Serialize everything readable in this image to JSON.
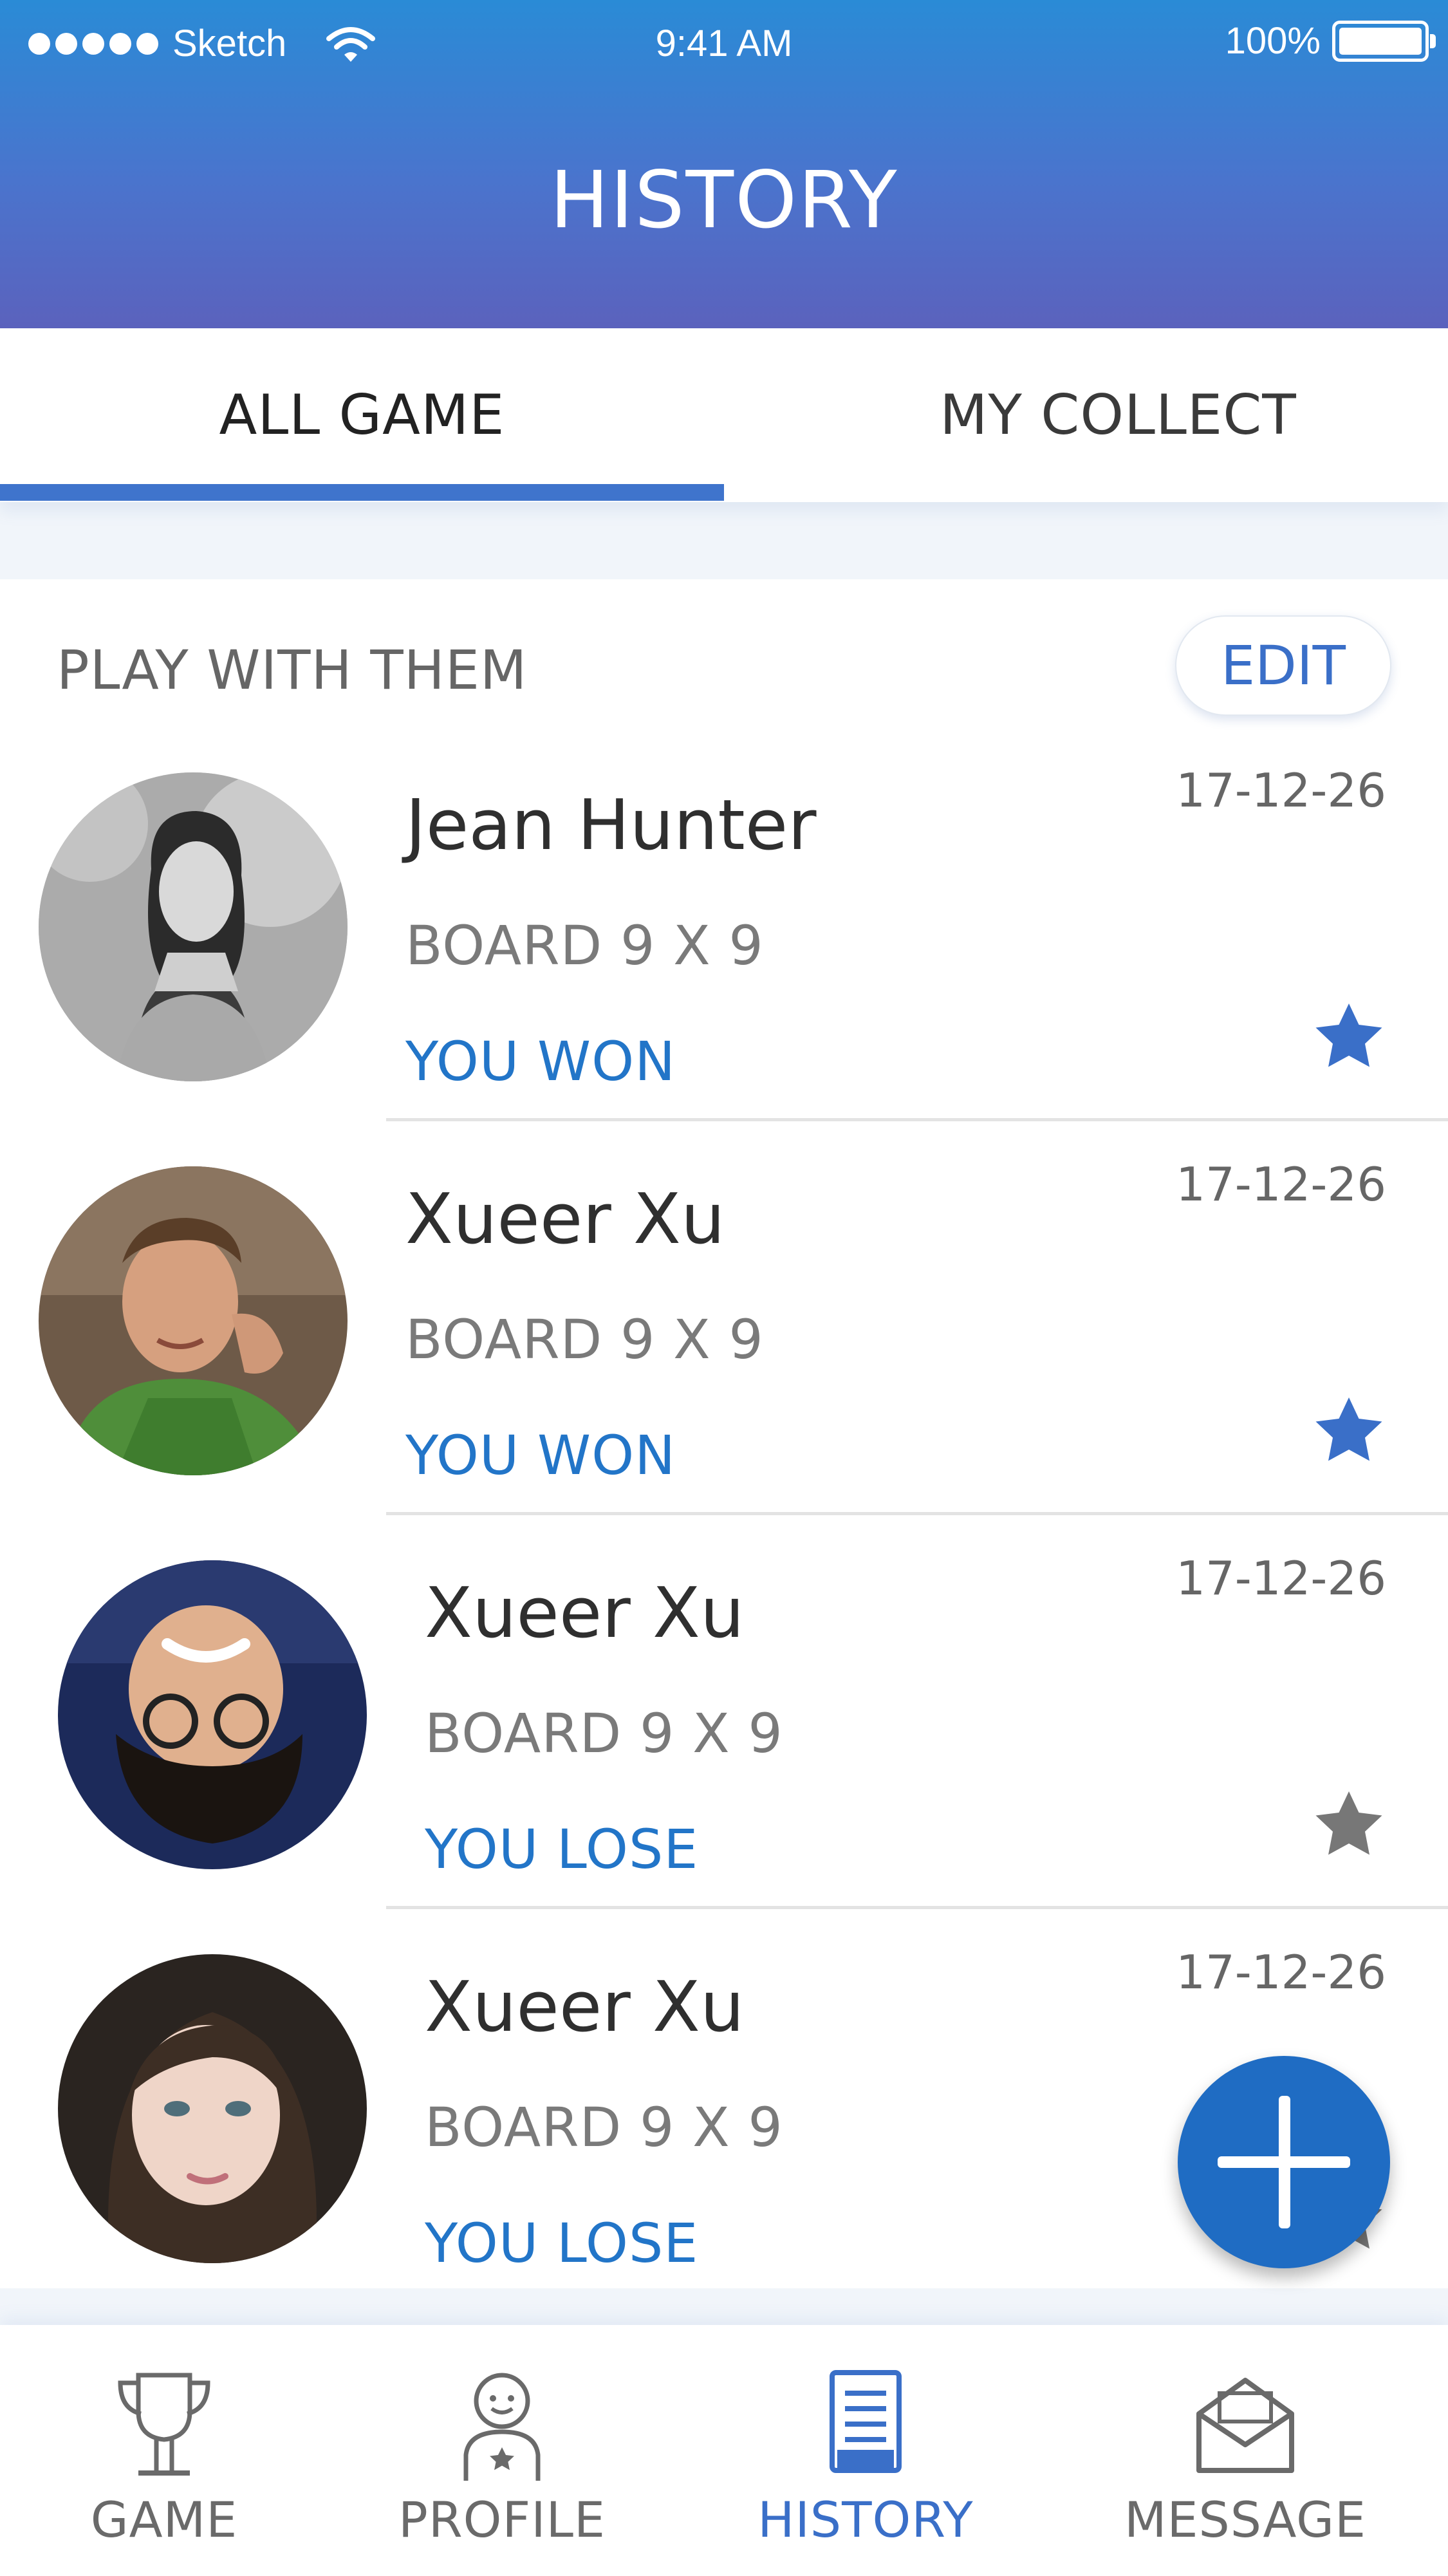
{
  "status_bar": {
    "carrier": "Sketch",
    "time": "9:41 AM",
    "battery": "100%"
  },
  "header": {
    "title": "HISTORY"
  },
  "tabs": [
    {
      "label": "ALL GAME",
      "active": true
    },
    {
      "label": "MY COLLECT",
      "active": false
    }
  ],
  "section": {
    "title": "PLAY WITH THEM",
    "edit_label": "EDIT"
  },
  "games": [
    {
      "name": "Jean Hunter",
      "board": "BOARD 9 X 9",
      "result": "YOU WON",
      "date": "17-12-26",
      "starred": true
    },
    {
      "name": "Xueer Xu",
      "board": "BOARD 9 X 9",
      "result": "YOU WON",
      "date": "17-12-26",
      "starred": true
    },
    {
      "name": "Xueer Xu",
      "board": "BOARD 9 X 9",
      "result": "YOU LOSE",
      "date": "17-12-26",
      "starred": false
    },
    {
      "name": "Xueer Xu",
      "board": "BOARD 9 X 9",
      "result": "YOU LOSE",
      "date": "17-12-26",
      "starred": false
    }
  ],
  "bottom_nav": [
    {
      "label": "GAME",
      "icon": "trophy-icon",
      "active": false
    },
    {
      "label": "PROFILE",
      "icon": "profile-icon",
      "active": false
    },
    {
      "label": "HISTORY",
      "icon": "history-document-icon",
      "active": true
    },
    {
      "label": "MESSAGE",
      "icon": "envelope-icon",
      "active": false
    }
  ],
  "colors": {
    "accent": "#3a6fc8",
    "result_text": "#2275c8",
    "star_active": "#3a6fc8",
    "star_inactive": "#777777",
    "fab": "#1f6cc3",
    "header_top": "#2a8bd6",
    "header_bottom": "#5b62bd"
  }
}
